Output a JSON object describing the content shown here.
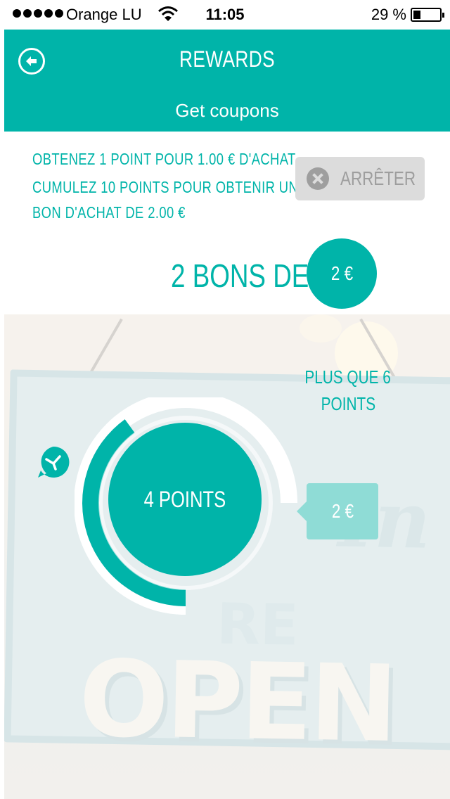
{
  "status_bar": {
    "carrier": "Orange LU",
    "time": "11:05",
    "battery_percent_label": "29 %",
    "battery_level": 0.29
  },
  "header": {
    "title": "REWARDS",
    "subtitle": "Get coupons",
    "back_icon": "back-arrow-icon",
    "background_color": "#00b4a9"
  },
  "program": {
    "line1": "OBTENEZ  1  POINT  POUR  1.00 €  D'ACHAT.",
    "line2": "CUMULEZ 10 POINTS POUR OBTENIR UN",
    "line3": "BON D'ACHAT DE  2.00 €",
    "stop_button_label": "ARRÊTER",
    "stop_icon": "close-circle-icon"
  },
  "vouchers": {
    "label": "2 BONS DE",
    "amount": "2 €"
  },
  "progress": {
    "current_points_label": "4 POINTS",
    "next_level_line1": "PLUS QUE 6",
    "next_level_line2": "POINTS",
    "reward_amount": "2 €",
    "current_points": 4,
    "goal_points": 10,
    "marker_icon": "location-pin-icon"
  },
  "colors": {
    "accent": "#00b4a9",
    "accent_light": "#8fdcd6",
    "button_gray": "#dcdcdc"
  }
}
